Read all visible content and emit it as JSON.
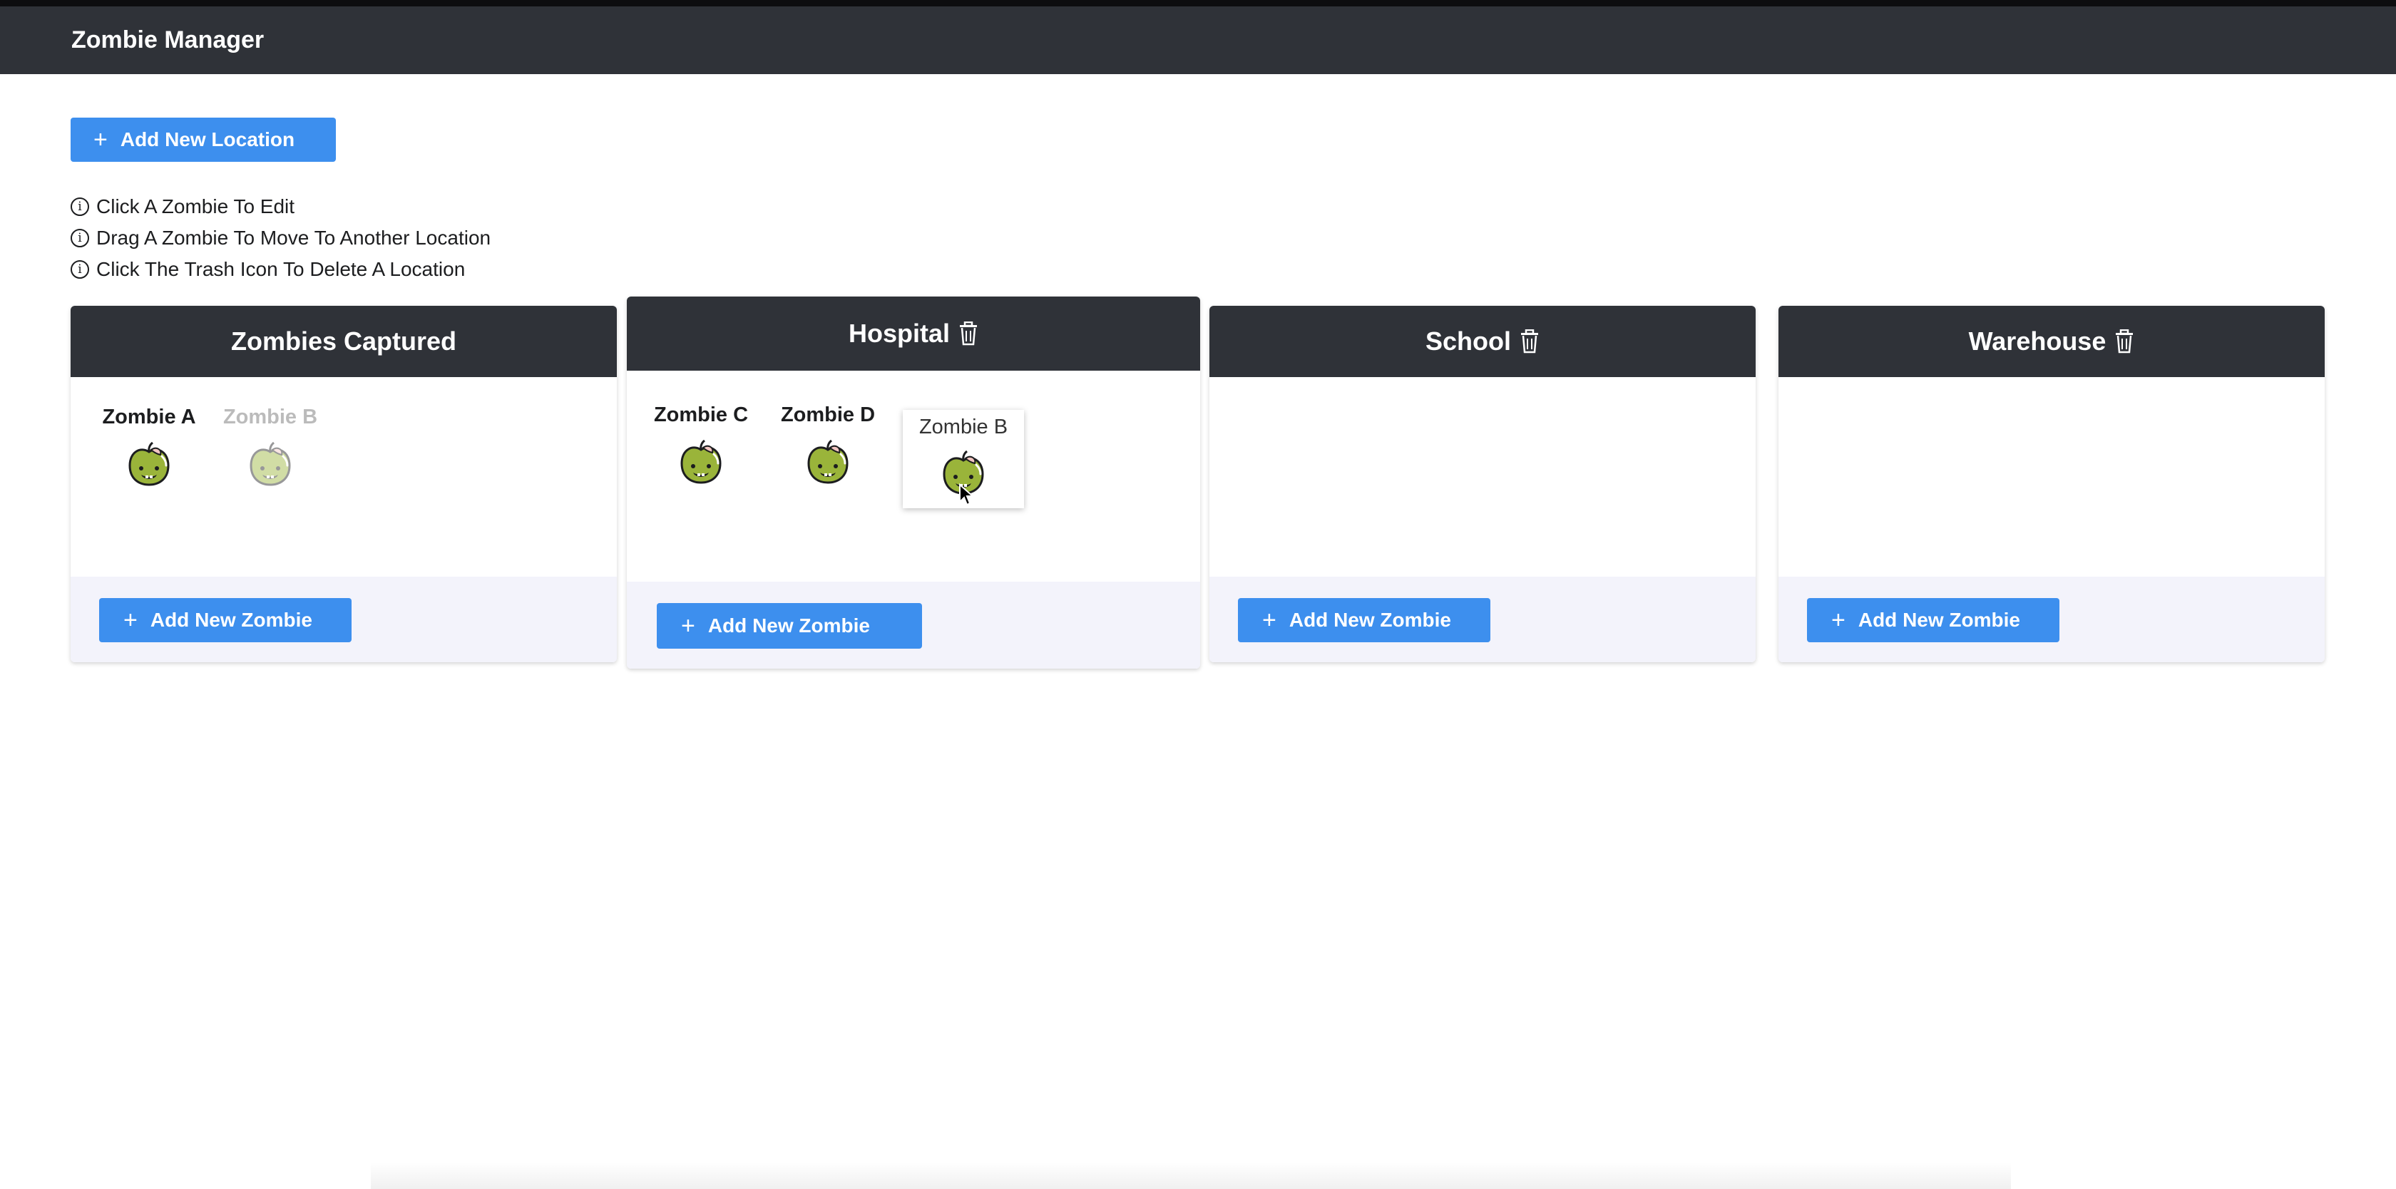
{
  "app": {
    "title": "Zombie Manager"
  },
  "toolbar": {
    "add_location_label": "Add New Location"
  },
  "instructions": [
    "Click A Zombie To Edit",
    "Drag A Zombie To Move To Another Location",
    "Click The Trash Icon To Delete A Location"
  ],
  "locations": [
    {
      "title": "Zombies Captured",
      "zombies": [
        "Zombie A",
        "Zombie B"
      ],
      "add_label": "Add New Zombie"
    },
    {
      "title": "Hospital",
      "zombies": [
        "Zombie C",
        "Zombie D"
      ],
      "add_label": "Add New Zombie"
    },
    {
      "title": "School",
      "zombies": [],
      "add_label": "Add New Zombie"
    },
    {
      "title": "Warehouse",
      "zombies": [],
      "add_label": "Add New Zombie"
    }
  ],
  "dragging": {
    "name": "Zombie B"
  },
  "colors": {
    "header": "#2f3238",
    "accent": "#3d8fee",
    "footer": "#f3f3fb",
    "zombie": "#9ab43a"
  }
}
